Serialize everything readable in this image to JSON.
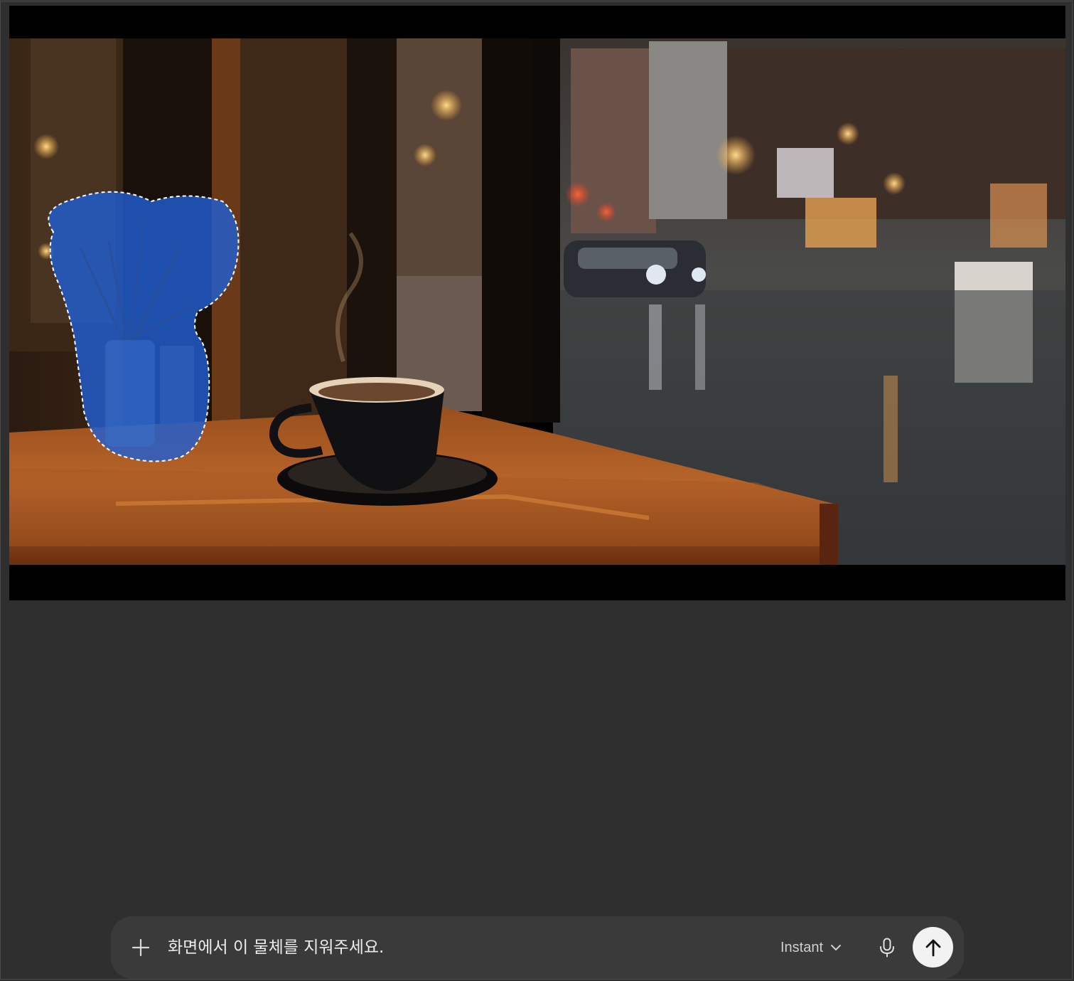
{
  "composer": {
    "prompt_text": "화면에서 이 물체를 지워주세요.",
    "model_label": "Instant"
  },
  "icons": {
    "add": "plus-icon",
    "model_dropdown": "chevron-down-icon",
    "voice": "microphone-icon",
    "send": "arrow-up-icon"
  },
  "colors": {
    "background": "#2f2f2f",
    "composer": "#3a3a3a",
    "selection_mask": "#1f5fd6",
    "send_button": "#f2f2f2"
  }
}
